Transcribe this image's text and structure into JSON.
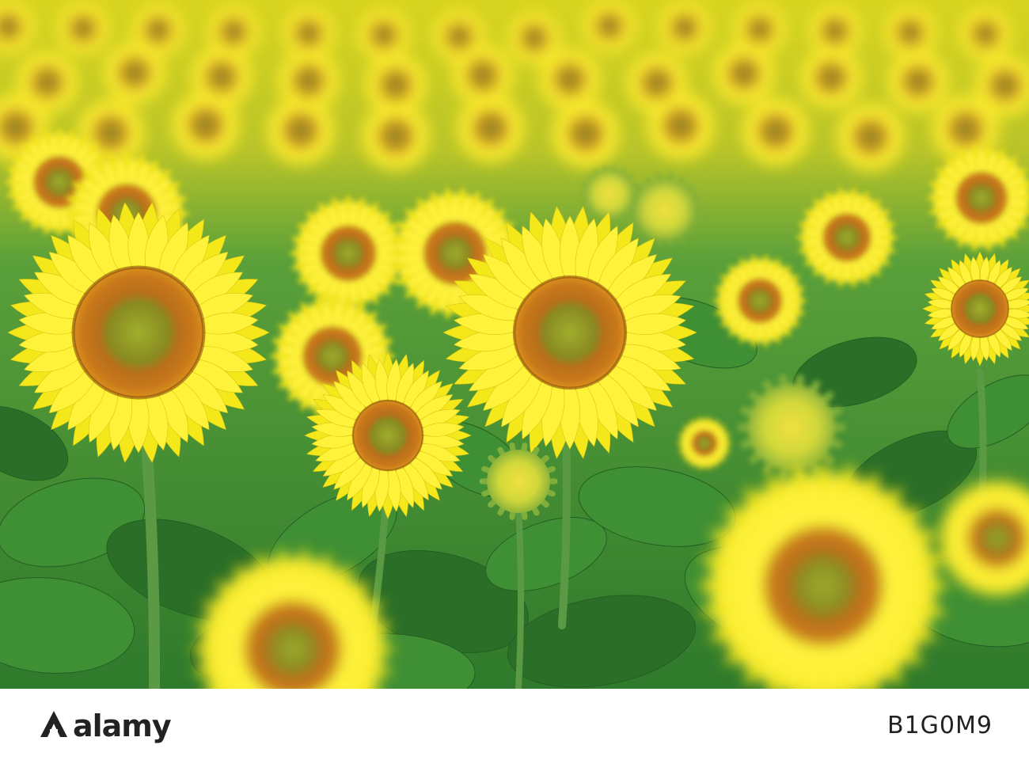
{
  "scene": {
    "subject": "sunflower field",
    "colors": {
      "sky_blur_yellow": "#e8d81a",
      "petal_yellow": "#f4e81a",
      "petal_bright": "#fff23a",
      "center_ring": "#b86a10",
      "center_inner": "#8a9a2a",
      "leaf_green": "#3f8f35",
      "leaf_dark": "#2b6e28",
      "stem_green": "#5a9a45"
    }
  },
  "watermark_bar": {
    "logo_text": "alamy",
    "image_id": "B1G0M9"
  }
}
